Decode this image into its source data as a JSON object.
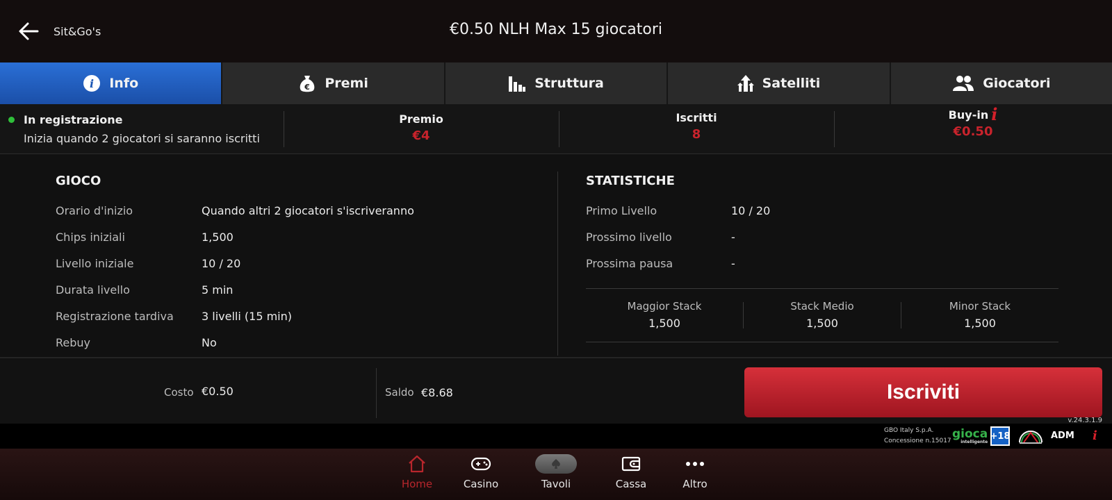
{
  "header": {
    "back_label": "Sit&Go's",
    "title": "€0.50 NLH Max 15 giocatori"
  },
  "tabs": [
    {
      "label": "Info",
      "icon": "info-icon",
      "active": true
    },
    {
      "label": "Premi",
      "icon": "money-bag-icon",
      "active": false
    },
    {
      "label": "Struttura",
      "icon": "bar-chart-icon",
      "active": false
    },
    {
      "label": "Satelliti",
      "icon": "satellite-arrows-icon",
      "active": false
    },
    {
      "label": "Giocatori",
      "icon": "players-icon",
      "active": false
    }
  ],
  "status": {
    "title": "In registrazione",
    "subtitle": "Inizia quando 2 giocatori si saranno iscritti",
    "premio_label": "Premio",
    "premio_value": "€4",
    "iscritti_label": "Iscritti",
    "iscritti_value": "8",
    "buyin_label": "Buy-in",
    "buyin_value": "€0.50",
    "buyin_info_glyph": "i",
    "status_color": "#2fbf3a"
  },
  "gioco": {
    "title": "GIOCO",
    "rows": [
      {
        "label": "Orario d'inizio",
        "value": "Quando altri 2 giocatori s'iscriveranno"
      },
      {
        "label": "Chips iniziali",
        "value": "1,500"
      },
      {
        "label": "Livello iniziale",
        "value": "10 / 20"
      },
      {
        "label": "Durata livello",
        "value": "5 min"
      },
      {
        "label": "Registrazione tardiva",
        "value": "3 livelli (15 min)"
      },
      {
        "label": "Rebuy",
        "value": "No"
      }
    ]
  },
  "statistiche": {
    "title": "STATISTICHE",
    "rows": [
      {
        "label": "Primo Livello",
        "value": "10 / 20"
      },
      {
        "label": "Prossimo livello",
        "value": "-"
      },
      {
        "label": "Prossima pausa",
        "value": "-"
      }
    ],
    "stacks": [
      {
        "label": "Maggior Stack",
        "value": "1,500"
      },
      {
        "label": "Stack Medio",
        "value": "1,500"
      },
      {
        "label": "Minor Stack",
        "value": "1,500"
      }
    ]
  },
  "footer": {
    "cost_label": "Costo",
    "cost_value": "€0.50",
    "saldo_label": "Saldo",
    "saldo_value": "€8.68",
    "join_label": "Iscriviti",
    "version": "v.24.3.1.9"
  },
  "legal": {
    "company": "GBO Italy S.p.A.",
    "license": "Concessione n.15017",
    "gioca_logo": "gioca",
    "gioca_sub": "intelligente",
    "age": "+18",
    "adm": "ADM",
    "info_glyph": "i"
  },
  "nav": [
    {
      "label": "Home",
      "icon": "home-icon",
      "active": true
    },
    {
      "label": "Casino",
      "icon": "gamepad-icon",
      "active": false
    },
    {
      "label": "Tavoli",
      "icon": "spade-icon",
      "active": false
    },
    {
      "label": "Cassa",
      "icon": "wallet-icon",
      "active": false
    },
    {
      "label": "Altro",
      "icon": "more-dots-icon",
      "active": false
    }
  ],
  "colors": {
    "accent_red": "#c9232c",
    "tab_active": "#2a6fd6",
    "nav_active": "#b8262c"
  }
}
